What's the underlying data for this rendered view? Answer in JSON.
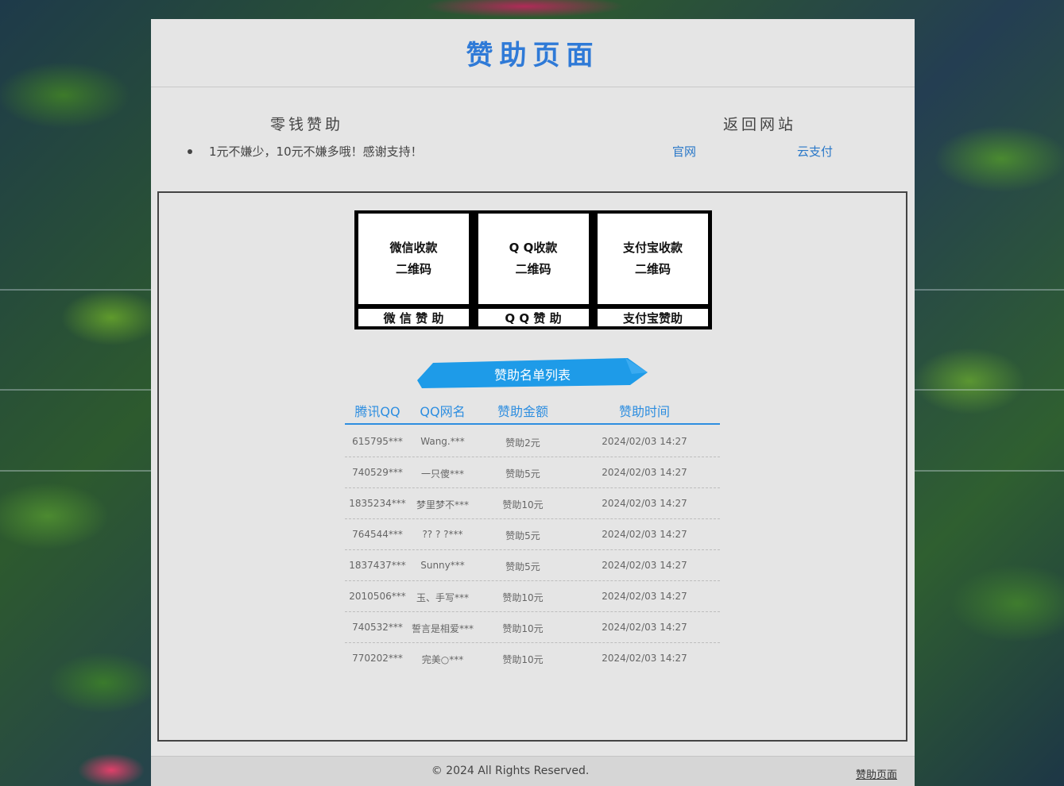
{
  "header": {
    "title": "赞助页面"
  },
  "info": {
    "left_title": "零钱赞助",
    "desc": "1元不嫌少，10元不嫌多哦！感谢支持！",
    "right_title": "返回网站",
    "links": [
      "官网",
      "云支付"
    ]
  },
  "qr_codes": [
    {
      "line1": "微信收款",
      "line2": "二维码",
      "label": "微 信 赞 助"
    },
    {
      "line1": "Q Q收款",
      "line2": "二维码",
      "label": "Q Q 赞 助"
    },
    {
      "line1": "支付宝收款",
      "line2": "二维码",
      "label": "支付宝赞助"
    }
  ],
  "list": {
    "ribbon_title": "赞助名单列表",
    "columns": [
      "腾讯QQ",
      "QQ网名",
      "赞助金额",
      "赞助时间"
    ],
    "rows": [
      [
        "615795***",
        "Wang.***",
        "赞助2元",
        "2024/02/03 14:27"
      ],
      [
        "740529***",
        "一只傻***",
        "赞助5元",
        "2024/02/03 14:27"
      ],
      [
        "1835234***",
        "梦里梦不***",
        "赞助10元",
        "2024/02/03 14:27"
      ],
      [
        "764544***",
        "?? ? ?***",
        "赞助5元",
        "2024/02/03 14:27"
      ],
      [
        "1837437***",
        "Sunny***",
        "赞助5元",
        "2024/02/03 14:27"
      ],
      [
        "2010506***",
        "玉、手写***",
        "赞助10元",
        "2024/02/03 14:27"
      ],
      [
        "740532***",
        "誓言是相爱***",
        "赞助10元",
        "2024/02/03 14:27"
      ],
      [
        "770202***",
        "完美○***",
        "赞助10元",
        "2024/02/03 14:27"
      ]
    ]
  },
  "footer": {
    "copyright": "© 2024 All Rights Reserved.",
    "link": "赞助页面"
  },
  "colors": {
    "accent": "#2f7ad7",
    "ribbon": "#1e9be8",
    "link": "#2a78c8"
  }
}
